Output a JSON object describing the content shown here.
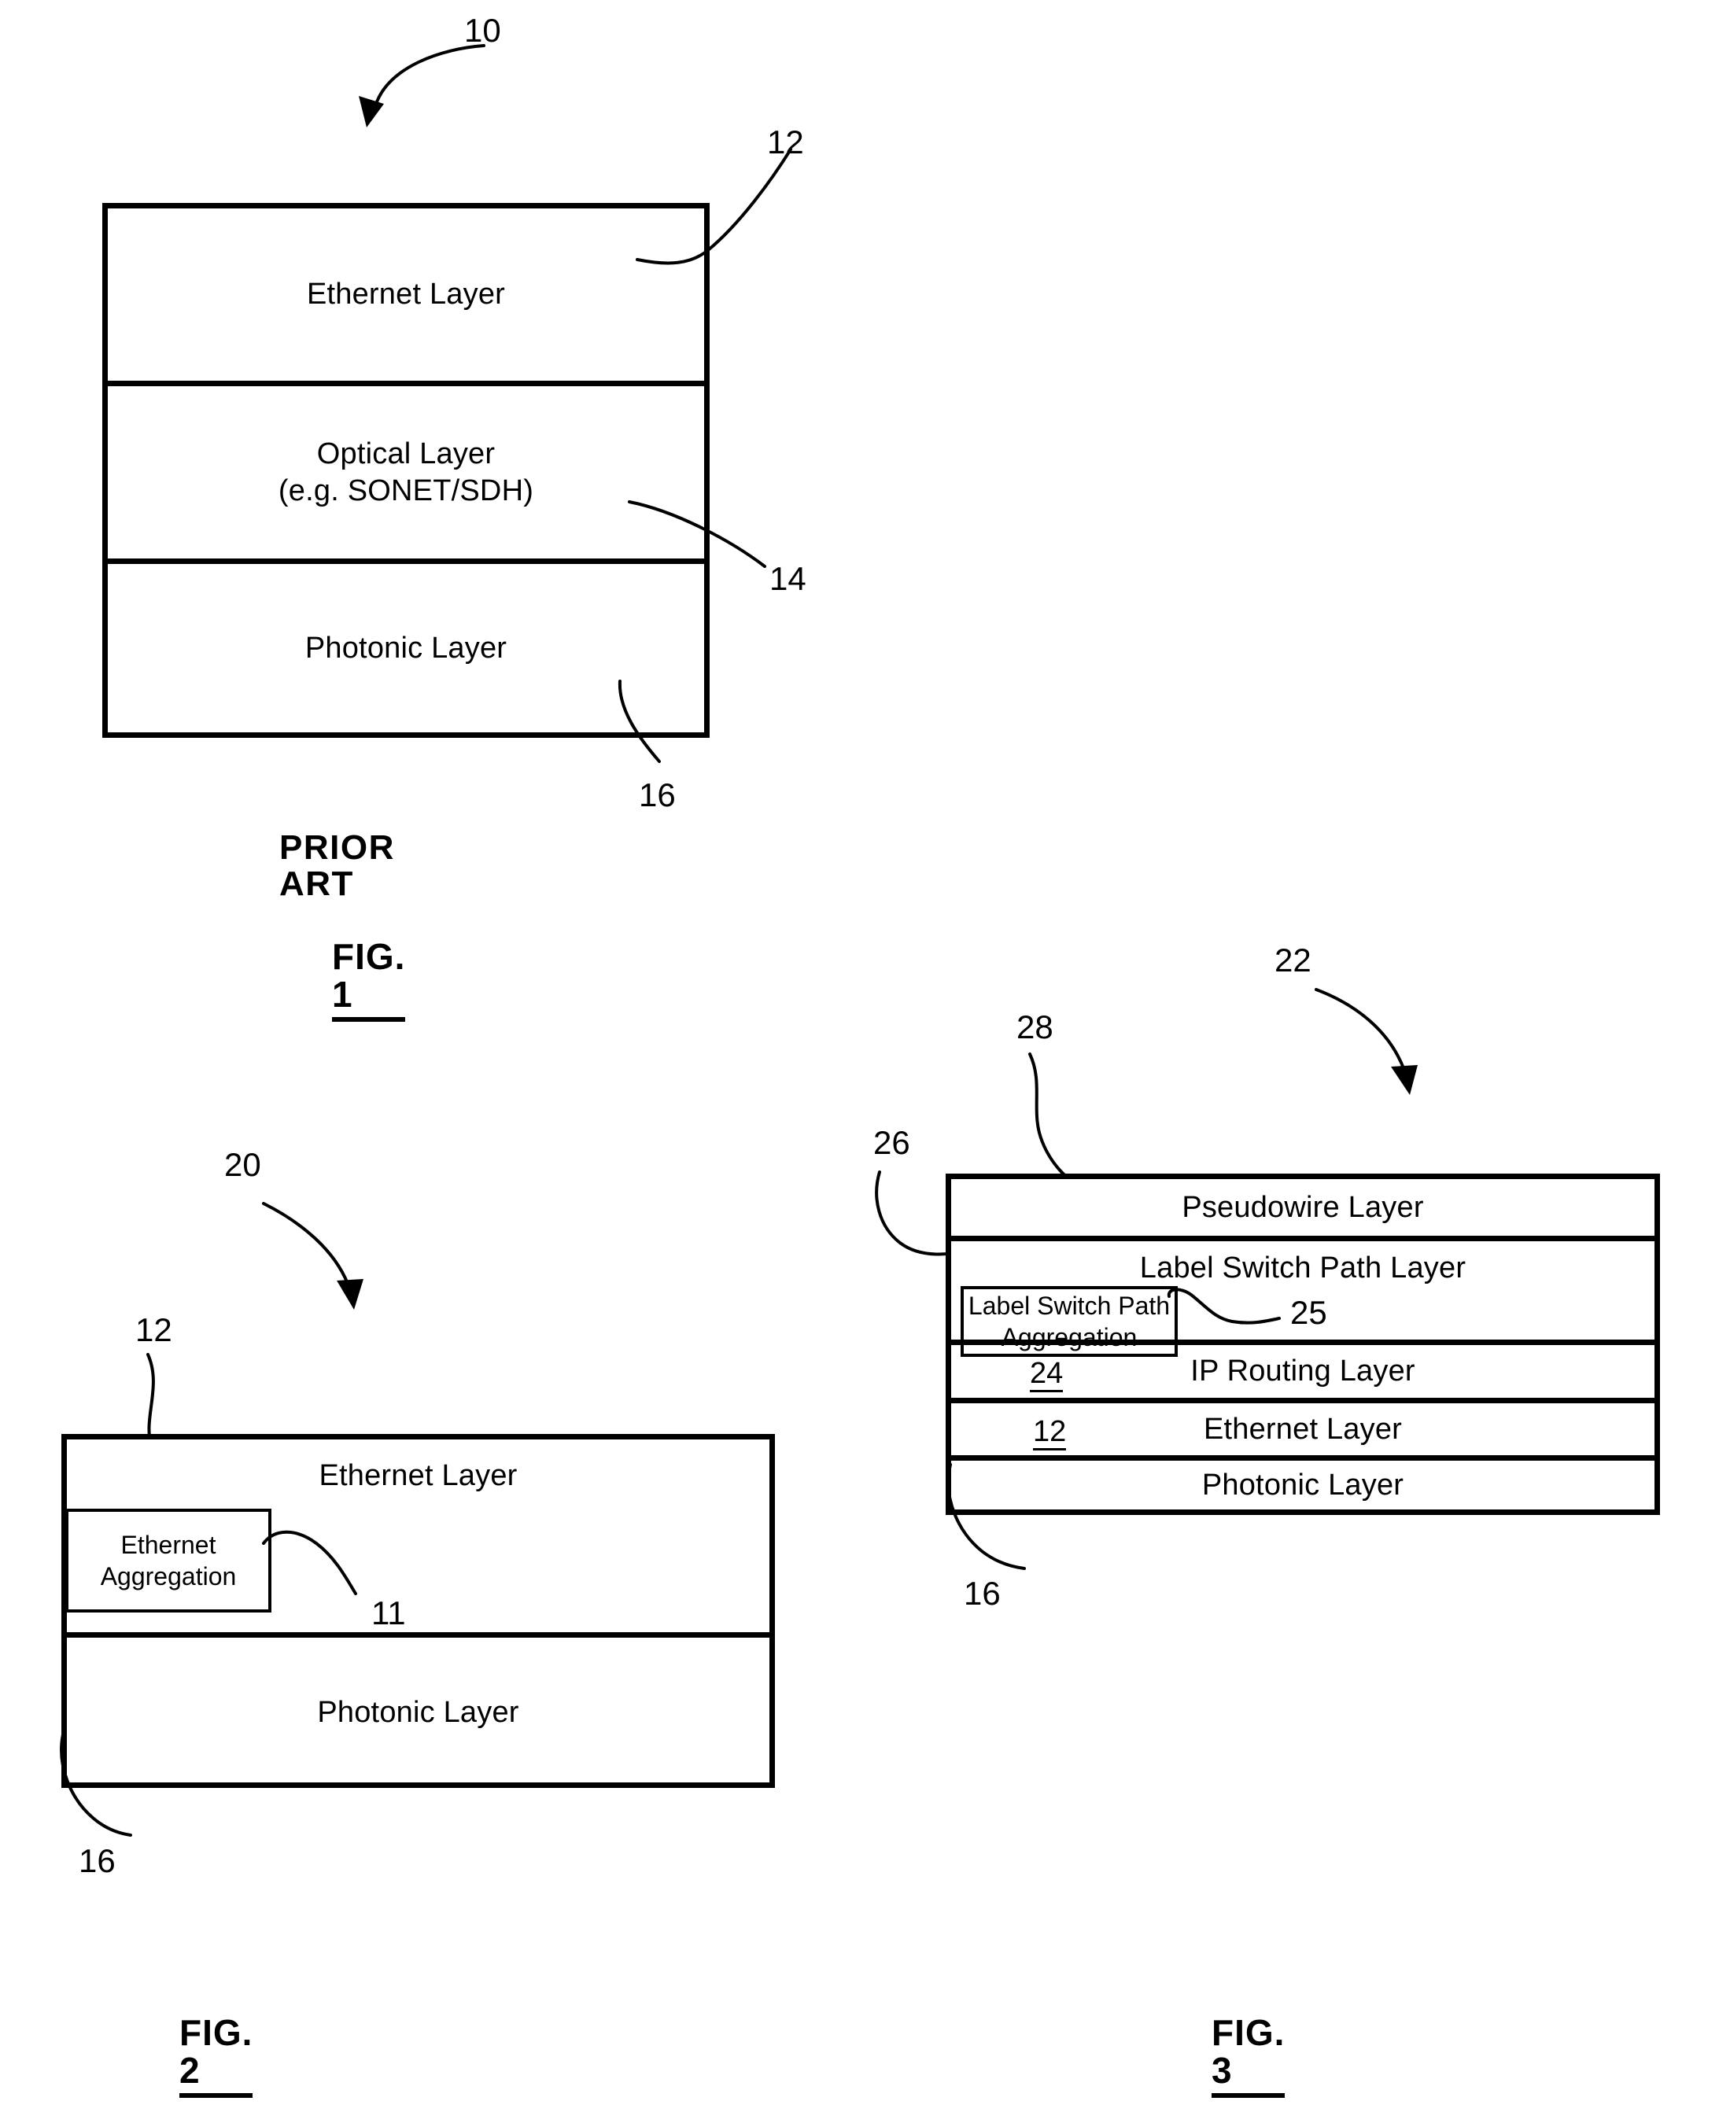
{
  "document": {
    "type": "patent-drawing-sheet",
    "background_color": "#ffffff",
    "ink_color": "#000000"
  },
  "figures": [
    {
      "id": "fig1",
      "caption": "FIG. 1",
      "note": "PRIOR ART",
      "stack_ref": "10",
      "layers": [
        {
          "label": "Ethernet Layer",
          "ref": "12"
        },
        {
          "label": "Optical Layer\n(e.g. SONET/SDH)",
          "ref": "14"
        },
        {
          "label": "Photonic Layer",
          "ref": "16"
        }
      ],
      "refs": [
        {
          "value": "10",
          "kind": "stack-pointer"
        },
        {
          "value": "12",
          "kind": "leader"
        },
        {
          "value": "14",
          "kind": "leader"
        },
        {
          "value": "16",
          "kind": "leader"
        }
      ]
    },
    {
      "id": "fig2",
      "caption": "FIG. 2",
      "stack_ref": "20",
      "layers": [
        {
          "label": "Ethernet Layer",
          "ref": "12"
        },
        {
          "label": "Photonic Layer",
          "ref": "16"
        }
      ],
      "sub_blocks": [
        {
          "label": "Ethernet Aggregation",
          "ref": "11",
          "parent": "Ethernet Layer"
        }
      ],
      "refs": [
        {
          "value": "20",
          "kind": "stack-pointer"
        },
        {
          "value": "12",
          "kind": "leader"
        },
        {
          "value": "11",
          "kind": "leader"
        },
        {
          "value": "16",
          "kind": "leader"
        }
      ]
    },
    {
      "id": "fig3",
      "caption": "FIG. 3",
      "stack_ref": "22",
      "layers": [
        {
          "label": "Pseudowire Layer",
          "ref": "28",
          "inline_ref": ""
        },
        {
          "label": "Label Switch Path Layer",
          "ref": "26",
          "inline_ref": ""
        },
        {
          "label": "IP Routing Layer",
          "ref": "",
          "inline_ref": "24"
        },
        {
          "label": "Ethernet Layer",
          "ref": "",
          "inline_ref": "12"
        },
        {
          "label": "Photonic Layer",
          "ref": "16",
          "inline_ref": ""
        }
      ],
      "sub_blocks": [
        {
          "label": "Label Switch Path\nAggregation",
          "ref": "25",
          "parent": "Label Switch Path Layer"
        }
      ],
      "refs": [
        {
          "value": "22",
          "kind": "stack-pointer"
        },
        {
          "value": "28",
          "kind": "leader"
        },
        {
          "value": "26",
          "kind": "leader"
        },
        {
          "value": "25",
          "kind": "leader"
        },
        {
          "value": "24",
          "kind": "inline"
        },
        {
          "value": "12",
          "kind": "inline"
        },
        {
          "value": "16",
          "kind": "leader"
        }
      ]
    }
  ],
  "fig1": {
    "ref_10": "10",
    "ref_12": "12",
    "ref_14": "14",
    "ref_16": "16",
    "layer1": "Ethernet Layer",
    "layer2": "Optical Layer\n(e.g. SONET/SDH)",
    "layer3": "Photonic Layer",
    "prior_art": "PRIOR ART",
    "caption": "FIG. 1"
  },
  "fig2": {
    "ref_20": "20",
    "ref_12": "12",
    "ref_11": "11",
    "ref_16": "16",
    "layer1": "Ethernet Layer",
    "sub1": "Ethernet Aggregation",
    "layer2": "Photonic Layer",
    "caption": "FIG. 2"
  },
  "fig3": {
    "ref_22": "22",
    "ref_28": "28",
    "ref_26": "26",
    "ref_25": "25",
    "ref_24": "24",
    "ref_12": "12",
    "ref_16": "16",
    "layer1": "Pseudowire Layer",
    "layer2": "Label Switch Path Layer",
    "sub1": "Label Switch Path\nAggregation",
    "layer3": "IP Routing Layer",
    "layer4": "Ethernet Layer",
    "layer5": "Photonic Layer",
    "caption": "FIG. 3"
  }
}
